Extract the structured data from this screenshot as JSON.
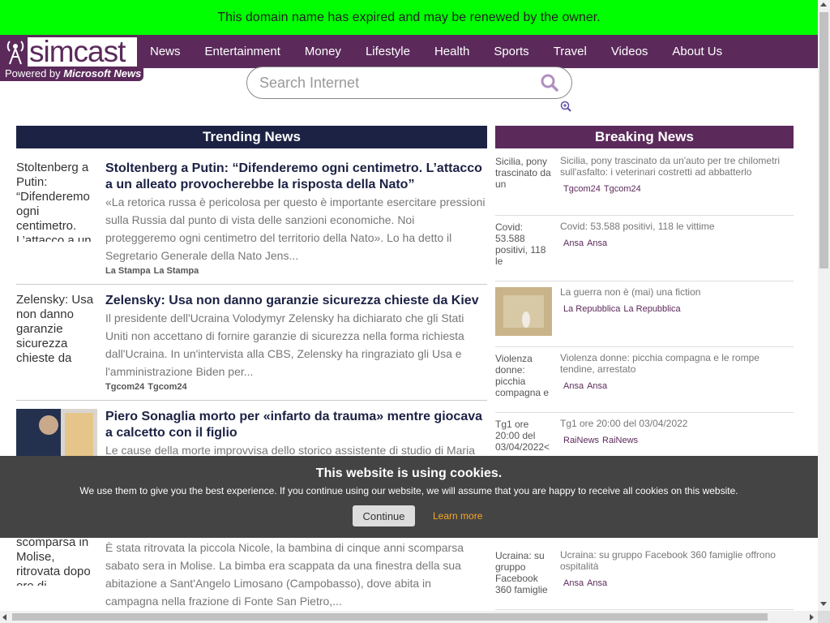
{
  "banner": {
    "text": "This domain name has expired and may be renewed by the owner."
  },
  "brand": {
    "logo_text": "simcast",
    "powered_prefix": "Powered by ",
    "powered_brand": "Microsoft News"
  },
  "nav": [
    "News",
    "Entertainment",
    "Money",
    "Lifestyle",
    "Health",
    "Sports",
    "Travel",
    "Videos",
    "About Us"
  ],
  "search": {
    "placeholder": "Search Internet"
  },
  "trending": {
    "heading": "Trending News",
    "items": [
      {
        "thumb_alt": "Stoltenberg a Putin: “Difenderemo ogni centimetro. L’attacco a un",
        "title": "Stoltenberg a Putin: “Difenderemo ogni centimetro. L’attacco a un alleato provocherebbe la risposta della Nato”",
        "desc": "«La retorica russa è pericolosa per questo è importante esercitare pressioni sulla Russia dal punto di vista delle sanzioni economiche. Noi proteggeremo ogni centimetro del territorio della Nato». Lo ha detto il Segretario Generale della Nato Jens...",
        "src_alt": "La Stampa",
        "src": "La Stampa"
      },
      {
        "thumb_alt": "Zelensky: Usa non danno garanzie sicurezza chieste da",
        "title": "Zelensky: Usa non danno garanzie sicurezza chieste da Kiev",
        "desc": "Il presidente dell'Ucraina Volodymyr Zelensky ha dichiarato che gli Stati Uniti non accettano di fornire garanzie di sicurezza nella forma richiesta dall'Ucraina. In un'intervista alla CBS, Zelensky ha ringraziato gli Usa e l'amministrazione Biden per...",
        "src_alt": "Tgcom24",
        "src": "Tgcom24"
      },
      {
        "thumb_alt": "",
        "title": "Piero Sonaglia morto per «infarto da trauma» mentre giocava a calcetto con il figlio",
        "desc": "Le cause della morte improvvisa dello storico assistente di studio di Maria",
        "src_alt": "",
        "src": ""
      },
      {
        "thumb_alt": "scomparsa in Molise, ritrovata dopo ore di",
        "title": "",
        "desc": "È stata ritrovata la piccola Nicole, la bambina di cinque anni scomparsa sabato sera in Molise. La bimba era scappata da una finestra della sua abitazione a Sant'Angelo Limosano (Campobasso), dove abita in campagna nella frazione di Fonte San Pietro,...",
        "src_alt": "",
        "src": ""
      }
    ]
  },
  "breaking": {
    "heading": "Breaking News",
    "items": [
      {
        "thumb_alt": "Sicilia, pony trascinato da un",
        "title": "Sicilia, pony trascinato da un'auto per tre chilometri sull'asfalto: i veterinari costretti ad abbatterlo",
        "src_alt": "Tgcom24",
        "src": "Tgcom24"
      },
      {
        "thumb_alt": "Covid: 53.588 positivi, 118 le",
        "title": "Covid: 53.588 positivi, 118 le vittime",
        "src_alt": "Ansa",
        "src": "Ansa"
      },
      {
        "thumb_alt": "",
        "title": "La guerra non è (mai) una fiction",
        "src_alt": "La Repubblica",
        "src": "La Repubblica"
      },
      {
        "thumb_alt": "Violenza donne: picchia compagna e",
        "title": "Violenza donne: picchia compagna e le rompe tendine, arrestato",
        "src_alt": "Ansa",
        "src": "Ansa"
      },
      {
        "thumb_alt": "Tg1 ore 20:00 del 03/04/2022<",
        "title": "Tg1 ore 20:00 del 03/04/2022",
        "src_alt": "RaiNews",
        "src": "RaiNews"
      },
      {
        "thumb_alt": "Ucraina: su gruppo Facebook 360 famiglie",
        "title": "Ucraina: su gruppo Facebook 360 famiglie offrono ospitalità",
        "src_alt": "Ansa",
        "src": "Ansa"
      }
    ]
  },
  "cookie": {
    "title": "This website is using cookies.",
    "text": "We use them to give you the best experience. If you continue using our website, we will assume that you are happy to receive all cookies on this website.",
    "continue": "Continue",
    "learn": "Learn more"
  }
}
